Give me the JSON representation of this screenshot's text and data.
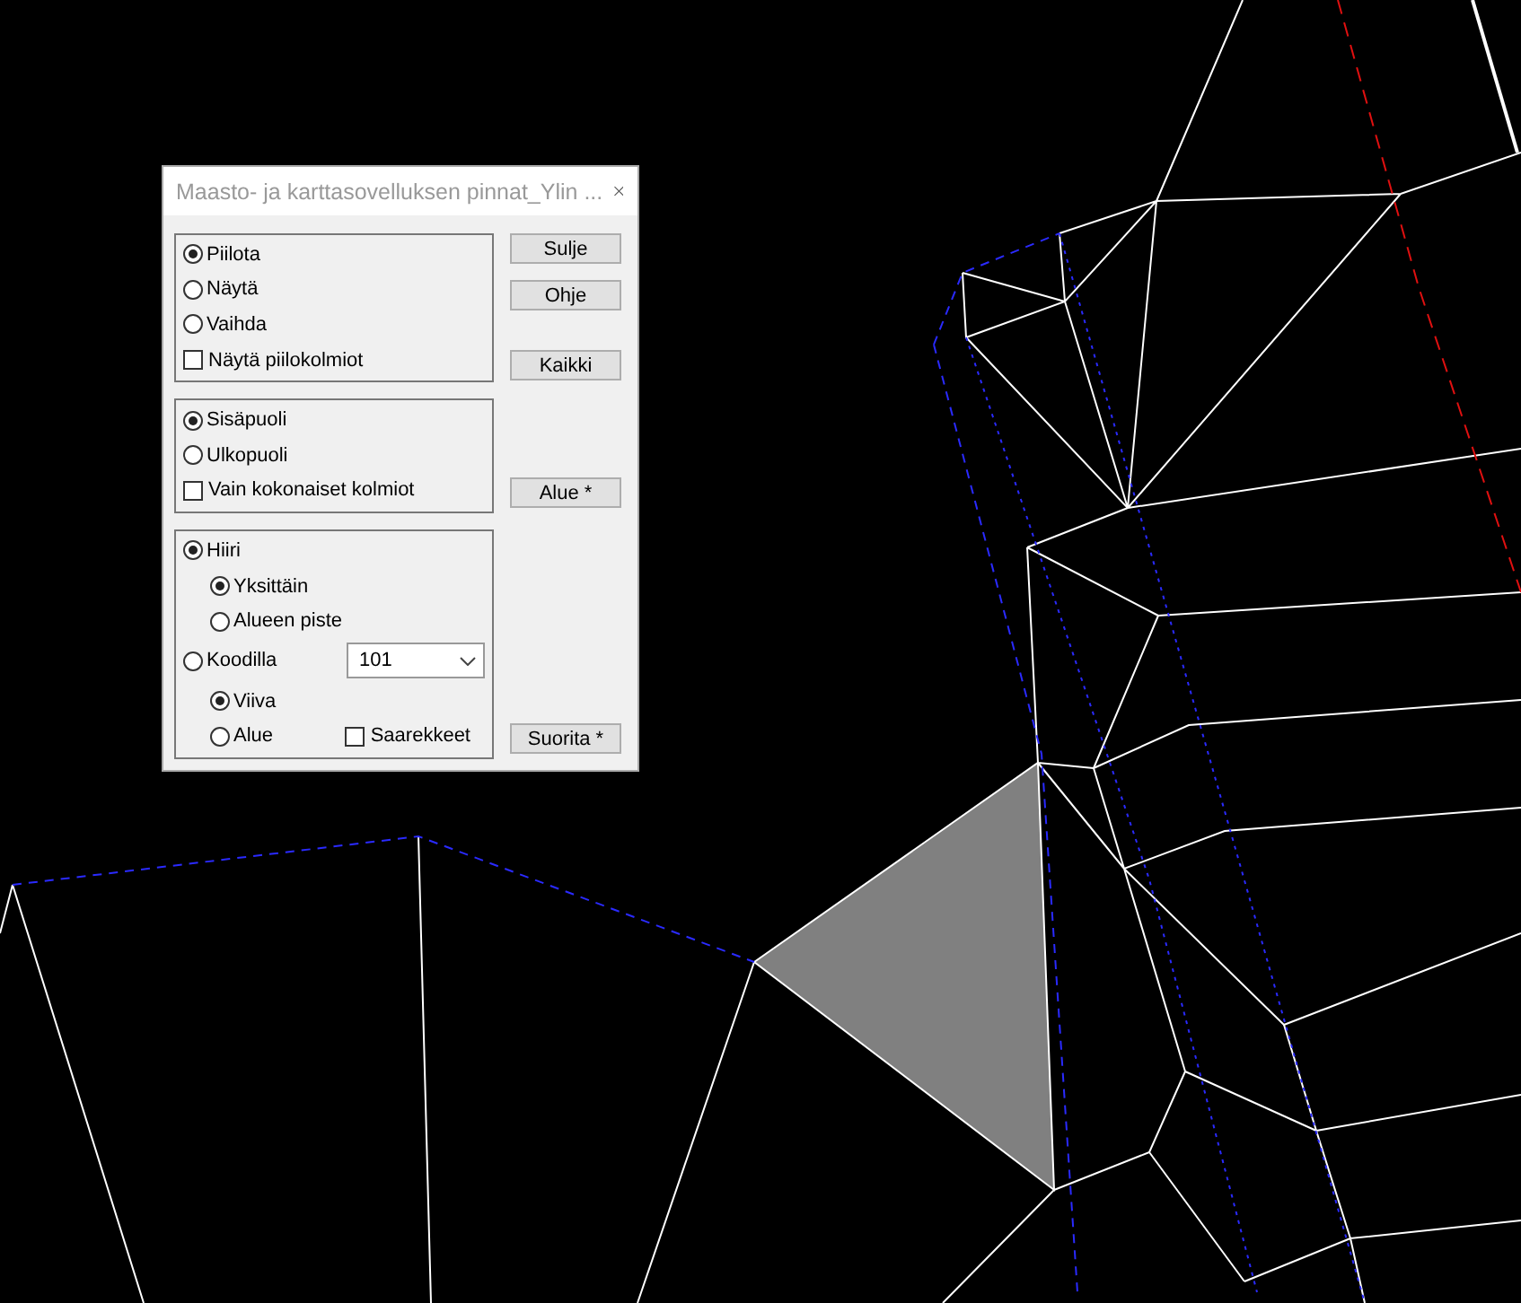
{
  "window": {
    "title": "Maasto- ja karttasovelluksen pinnat_Ylin ..."
  },
  "groups": [
    {
      "items": [
        {
          "kind": "radio",
          "label": "Piilota",
          "selected": true
        },
        {
          "kind": "radio",
          "label": "Näytä",
          "selected": false
        },
        {
          "kind": "radio",
          "label": "Vaihda",
          "selected": false
        },
        {
          "kind": "checkbox",
          "label": "Näytä piilokolmiot",
          "checked": false
        }
      ]
    },
    {
      "items": [
        {
          "kind": "radio",
          "label": "Sisäpuoli",
          "selected": true
        },
        {
          "kind": "radio",
          "label": "Ulkopuoli",
          "selected": false
        },
        {
          "kind": "checkbox",
          "label": "Vain kokonaiset kolmiot",
          "checked": false
        }
      ]
    },
    {
      "items": [
        {
          "kind": "radio",
          "label": "Hiiri",
          "selected": true,
          "children": [
            {
              "kind": "radio",
              "label": "Yksittäin",
              "selected": true
            },
            {
              "kind": "radio",
              "label": "Alueen piste",
              "selected": false
            }
          ]
        },
        {
          "kind": "radio",
          "label": "Koodilla",
          "selected": false,
          "dropdown": {
            "value": "101"
          },
          "children": [
            {
              "kind": "radio",
              "label": "Viiva",
              "selected": true
            },
            {
              "kind": "radio",
              "label": "Alue",
              "selected": false,
              "checkbox": {
                "label": "Saarekkeet",
                "checked": false
              }
            }
          ]
        }
      ]
    }
  ],
  "buttons": [
    "Sulje",
    "Ohje",
    "Kaikki",
    "Alue *",
    "Suorita *"
  ]
}
